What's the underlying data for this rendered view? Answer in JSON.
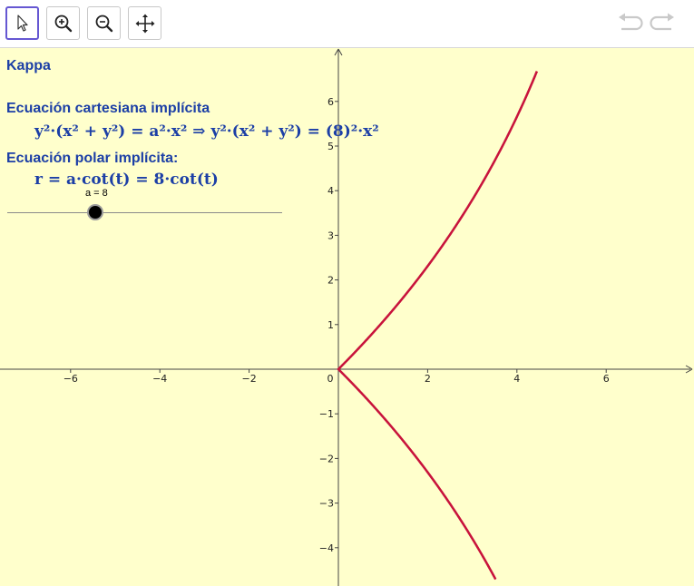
{
  "toolbar": {
    "tools": [
      {
        "name": "move-tool",
        "icon": "arrow-pointer-icon",
        "selected": true
      },
      {
        "name": "zoom-in-tool",
        "icon": "zoom-in-icon",
        "selected": false
      },
      {
        "name": "zoom-out-tool",
        "icon": "zoom-out-icon",
        "selected": false
      },
      {
        "name": "move-graphics-view-tool",
        "icon": "move-arrows-icon",
        "selected": false
      }
    ],
    "undo_icon": "undo-icon",
    "redo_icon": "redo-icon",
    "accent_color": "#6557d2"
  },
  "graphics": {
    "background": "#ffffcc",
    "curve_color": "#c8143c",
    "text_color": "#1c3fa6",
    "title": "Kappa",
    "cartesian_heading": "Ecuación cartesiana implícita",
    "cartesian_equation": "y²·(x² + y²) = a²·x² ⇒ y²·(x² + y²) = (8)²·x²",
    "polar_heading": "Ecuación polar implícita:",
    "polar_equation": "r = a·cot(t) = 8·cot(t)",
    "slider": {
      "label": "a = 8",
      "value": 8
    }
  },
  "chart_data": {
    "type": "line",
    "title": "",
    "xlabel": "",
    "ylabel": "",
    "xlim": [
      -7.6,
      8.0
    ],
    "ylim": [
      -4.75,
      6.7
    ],
    "x_ticks": [
      "−6",
      "−4",
      "−2",
      "0",
      "2",
      "4",
      "6"
    ],
    "y_ticks": [
      "−4",
      "−3",
      "−2",
      "−1",
      "1",
      "2",
      "3",
      "4",
      "5",
      "6"
    ],
    "grid": false,
    "series": [
      {
        "name": "",
        "curve": "kappa",
        "parameter_a": 8
      }
    ]
  }
}
